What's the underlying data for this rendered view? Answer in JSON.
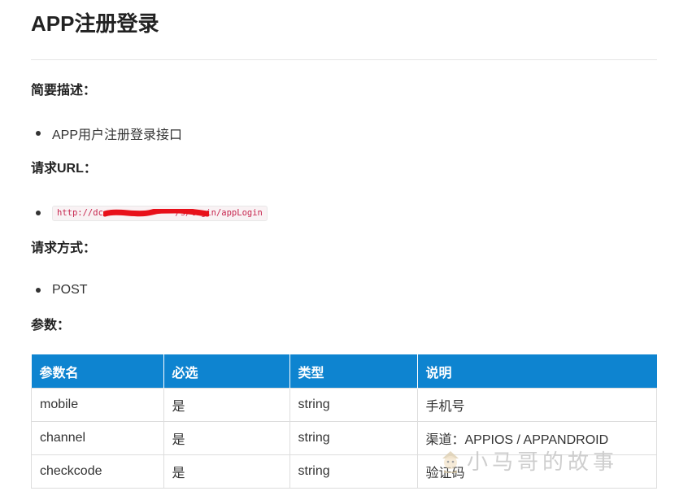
{
  "page": {
    "title": "APP注册登录"
  },
  "description": {
    "heading": "简要描述：",
    "items": [
      "APP用户注册登录接口"
    ]
  },
  "request_url": {
    "heading": "请求URL：",
    "url": "http://dc              /s/login/appLogin"
  },
  "request_method": {
    "heading": "请求方式：",
    "value": "POST"
  },
  "params": {
    "heading": "参数：",
    "headers": [
      "参数名",
      "必选",
      "类型",
      "说明"
    ],
    "rows": [
      [
        "mobile",
        "是",
        "string",
        "手机号"
      ],
      [
        "channel",
        "是",
        "string",
        "渠道：APPIOS / APPANDROID"
      ],
      [
        "checkcode",
        "是",
        "string",
        "验证码"
      ]
    ]
  },
  "watermark": {
    "text": "小马哥的故事"
  },
  "colors": {
    "table_header": "#0e84d0",
    "code_text": "#c7254e",
    "redaction": "#e8101a"
  }
}
